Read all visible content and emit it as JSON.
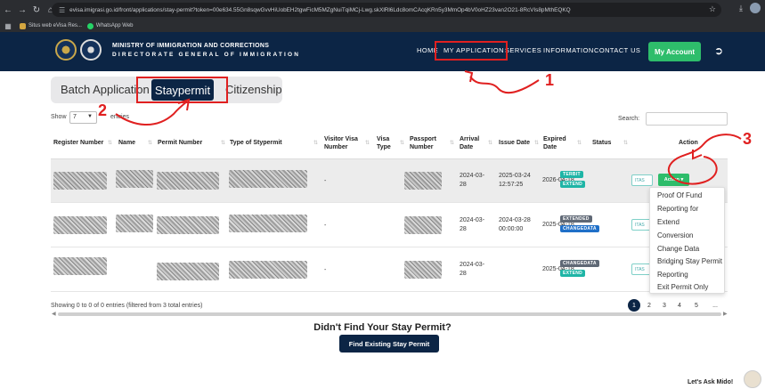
{
  "browser": {
    "url": "evisa.imigrasi.go.id/front/applications/stay-permit?token=00e634.55Gn8sqwGvvHiUobEH2tgwFicM5MZgNuiTqiMCj-Lwg.skXlRl6Ldc8omCAcqKRn5y3MmOp4bV0oHZ23van2O21-8RcVIs8pMthEQKQ",
    "bookmarks": [
      "Situs web eVisa Res...",
      "WhatsApp Web"
    ]
  },
  "header": {
    "ministry": "MINISTRY OF IMMIGRATION AND CORRECTIONS",
    "directorate": "DIRECTORATE GENERAL OF IMMIGRATION",
    "nav": [
      "HOME",
      "MY APPLICATION",
      "SERVICES",
      "INFORMATION",
      "CONTACT US"
    ],
    "account_label": "My Account"
  },
  "tabs": {
    "batch": "Batch Application",
    "staypermit": "Staypermit",
    "citizenship": "Citizenship"
  },
  "controls": {
    "show_label": "Show",
    "show_value": "7",
    "entries_label": "entries",
    "search_label": "Search:"
  },
  "table": {
    "headers": [
      "Register Number",
      "Name",
      "Permit Number",
      "Type of Stypermit",
      "Visitor Visa Number",
      "Visa Type",
      "Passport Number",
      "Arrival Date",
      "Issue Date",
      "Expired Date",
      "Status",
      "Action"
    ],
    "rows": [
      {
        "visitor": "-",
        "arrival": "2024-03-28",
        "issue": "2025-03-24 12:57:25",
        "expired": "2026-04-18",
        "badges": [
          "TERBIT",
          "EXTEND"
        ]
      },
      {
        "visitor": "-",
        "arrival": "2024-03-28",
        "issue": "2024-03-28 00:00:00",
        "expired": "2025-04-18",
        "badges": [
          "EXTENDED",
          "CHANGEDATA"
        ]
      },
      {
        "visitor": "-",
        "arrival": "2024-03-28",
        "issue": "",
        "expired": "2025-04-18",
        "badges": [
          "CHANGEDATA",
          "EXTEND"
        ]
      }
    ],
    "itas_label": "ITAS",
    "action_label": "Action"
  },
  "dropdown": [
    "Proof Of Fund",
    "Reporting for",
    "Extend",
    "Conversion",
    "Change Data",
    "Bridging Stay Permit",
    "Reporting",
    "Exit Permit Only"
  ],
  "footer": {
    "showing": "Showing 0 to 0 of 0 entries (filtered from 3 total entries)",
    "pages": [
      "1",
      "2",
      "3",
      "4",
      "5",
      "..."
    ],
    "didnt_find": "Didn't Find Your Stay Permit?",
    "find_button": "Find Existing Stay Permit",
    "chat": "Let's Ask Mido!"
  },
  "annotations": {
    "one": "1",
    "two": "2",
    "three": "3"
  },
  "colors": {
    "navy": "#0c2545",
    "green": "#2ebd6b",
    "annotation_red": "#e02020"
  }
}
